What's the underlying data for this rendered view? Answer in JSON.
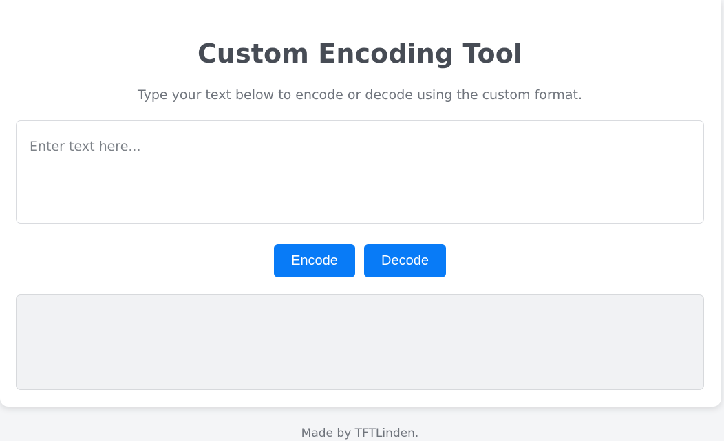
{
  "header": {
    "title": "Custom Encoding Tool",
    "subtitle": "Type your text below to encode or decode using the custom format."
  },
  "input": {
    "value": "",
    "placeholder": "Enter text here..."
  },
  "actions": {
    "encode_label": "Encode",
    "decode_label": "Decode"
  },
  "output": {
    "value": ""
  },
  "footer": {
    "text": "Made by TFTLinden."
  },
  "colors": {
    "accent": "#087bf7",
    "background": "#f4f5f7",
    "card": "#ffffff",
    "title_text": "#474c55",
    "muted_text": "#6f747c",
    "output_background": "#f1f2f4"
  }
}
